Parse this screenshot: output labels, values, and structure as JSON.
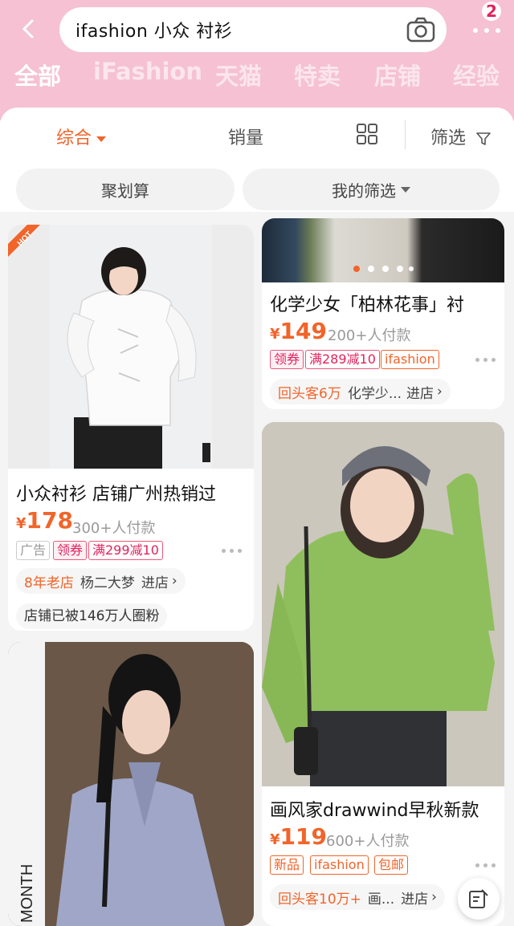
{
  "search": {
    "query": "ifashion 小众 衬衫"
  },
  "badge_count": "2",
  "categories": [
    "全部",
    "iFashion",
    "天猫",
    "特卖",
    "店铺",
    "经验"
  ],
  "sort_bar": {
    "comprehensive": "综合",
    "sales": "销量",
    "filter": "筛选"
  },
  "pills": {
    "left": "聚划算",
    "right": "我的筛选"
  },
  "products": [
    {
      "title": "化学少女「柏林花事」衬",
      "currency": "¥",
      "price": "149",
      "sold": "200+人付款",
      "tags": [
        "领券",
        "满289减10",
        "ifashion"
      ],
      "shop_badge": "回头客6万",
      "shop_name": "化学少...",
      "enter": "进店"
    },
    {
      "title": "小众衬衫 店铺广州热销过",
      "currency": "¥",
      "price": "178",
      "sold": "300+人付款",
      "tags": [
        "广告",
        "领券",
        "满299减10"
      ],
      "shop_badge": "8年老店",
      "shop_name": "杨二大梦",
      "enter": "进店",
      "fans": "店铺已被146万人圈粉",
      "hot_label": "HOT"
    },
    {
      "title": "画风家drawwind早秋新款",
      "currency": "¥",
      "price": "119",
      "sold": "600+人付款",
      "tags": [
        "新品",
        "ifashion",
        "包邮"
      ],
      "shop_badge": "回头客10万+",
      "shop_name": "画...",
      "enter": "进店"
    },
    {
      "image_text": "MONTH"
    }
  ],
  "colors": {
    "header_pink": "#f5c1d3",
    "accent_orange": "#f1642a",
    "tag_red": "#e0245e"
  },
  "icons": [
    "back-arrow-icon",
    "camera-icon",
    "more-dots-icon",
    "grid-view-icon",
    "filter-funnel-icon",
    "caret-down-icon",
    "edit-note-icon"
  ]
}
